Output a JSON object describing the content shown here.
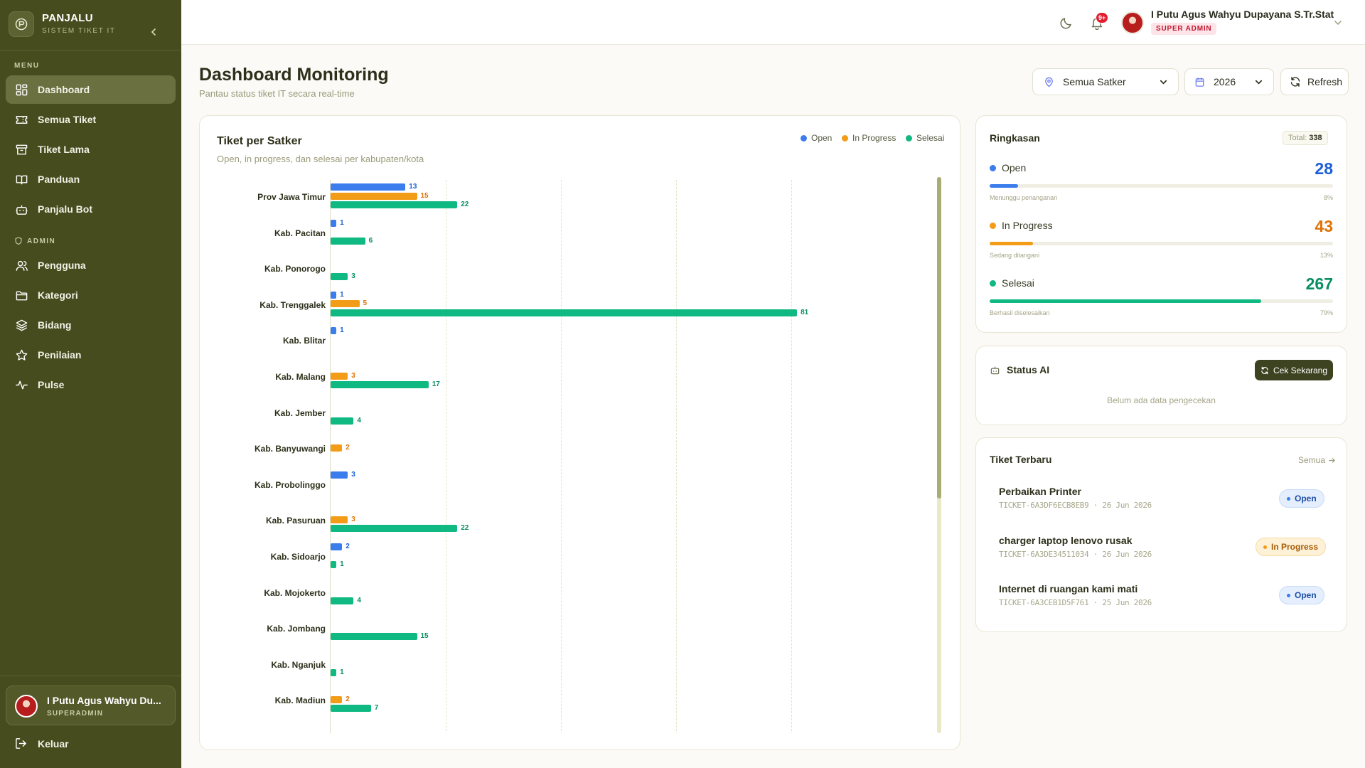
{
  "brand": {
    "name": "PANJALU",
    "subtitle": "SISTEM TIKET IT"
  },
  "sidebar": {
    "menu_label": "MENU",
    "admin_label": "ADMIN",
    "items": [
      {
        "label": "Dashboard",
        "icon": "grid-icon",
        "active": true
      },
      {
        "label": "Semua Tiket",
        "icon": "ticket-icon"
      },
      {
        "label": "Tiket Lama",
        "icon": "archive-icon"
      },
      {
        "label": "Panduan",
        "icon": "book-icon"
      },
      {
        "label": "Panjalu Bot",
        "icon": "bot-icon"
      }
    ],
    "admin_items": [
      {
        "label": "Pengguna",
        "icon": "users-icon"
      },
      {
        "label": "Kategori",
        "icon": "folder-icon"
      },
      {
        "label": "Bidang",
        "icon": "layers-icon"
      },
      {
        "label": "Penilaian",
        "icon": "star-icon"
      },
      {
        "label": "Pulse",
        "icon": "activity-icon"
      }
    ],
    "user": {
      "name": "I Putu Agus Wahyu Du...",
      "role": "SUPERADMIN"
    },
    "logout_label": "Keluar"
  },
  "topbar": {
    "notification_badge": "9+",
    "user_name": "I Putu Agus Wahyu Dupayana S.Tr.Stat",
    "user_role": "SUPER ADMIN"
  },
  "header": {
    "title": "Dashboard Monitoring",
    "subtitle": "Pantau status tiket IT secara real-time",
    "satker_filter": "Semua Satker",
    "year_filter": "2026",
    "refresh_label": "Refresh"
  },
  "colors": {
    "open": "#3b7ded",
    "in_progress": "#f39c17",
    "selesai": "#10b981",
    "sidebar": "#474c1e"
  },
  "chart_card": {
    "title": "Tiket per Satker",
    "subtitle": "Open, in progress, dan selesai per kabupaten/kota",
    "legend": [
      "Open",
      "In Progress",
      "Selesai"
    ]
  },
  "chart_data": {
    "type": "bar",
    "orientation": "horizontal",
    "categories": [
      "Prov Jawa Timur",
      "Kab. Pacitan",
      "Kab. Ponorogo",
      "Kab. Trenggalek",
      "Kab. Blitar",
      "Kab. Malang",
      "Kab. Jember",
      "Kab. Banyuwangi",
      "Kab. Probolinggo",
      "Kab. Pasuruan",
      "Kab. Sidoarjo",
      "Kab. Mojokerto",
      "Kab. Jombang",
      "Kab. Nganjuk",
      "Kab. Madiun"
    ],
    "series": [
      {
        "name": "Open",
        "values": [
          13,
          1,
          0,
          1,
          1,
          0,
          0,
          0,
          3,
          0,
          2,
          0,
          0,
          0,
          0
        ]
      },
      {
        "name": "In Progress",
        "values": [
          15,
          0,
          0,
          5,
          0,
          3,
          0,
          2,
          0,
          3,
          0,
          0,
          0,
          0,
          2
        ]
      },
      {
        "name": "Selesai",
        "values": [
          22,
          6,
          3,
          81,
          0,
          17,
          4,
          0,
          0,
          22,
          1,
          4,
          15,
          1,
          7
        ]
      }
    ],
    "xlim": [
      0,
      100
    ],
    "grid": true,
    "legend_position": "top-right"
  },
  "summary": {
    "title": "Ringkasan",
    "total_label": "Total:",
    "total": "338",
    "stats": [
      {
        "label": "Open",
        "value": "28",
        "note": "Menunggu penanganan",
        "pct": "8%",
        "fraction": 0.083
      },
      {
        "label": "In Progress",
        "value": "43",
        "note": "Sedang ditangani",
        "pct": "13%",
        "fraction": 0.127
      },
      {
        "label": "Selesai",
        "value": "267",
        "note": "Berhasil diselesaikan",
        "pct": "79%",
        "fraction": 0.79
      }
    ]
  },
  "ai_status": {
    "title": "Status AI",
    "button": "Cek Sekarang",
    "empty": "Belum ada data pengecekan"
  },
  "recent": {
    "title": "Tiket Terbaru",
    "see_all": "Semua",
    "tickets": [
      {
        "title": "Perbaikan Printer",
        "meta": "TICKET-6A3DF6ECB8EB9 · 26 Jun 2026",
        "status": "Open"
      },
      {
        "title": "charger laptop lenovo rusak",
        "meta": "TICKET-6A3DE34511034 · 26 Jun 2026",
        "status": "In Progress"
      },
      {
        "title": "Internet di ruangan kami mati",
        "meta": "TICKET-6A3CEB1D5F761 · 25 Jun 2026",
        "status": "Open"
      }
    ]
  }
}
